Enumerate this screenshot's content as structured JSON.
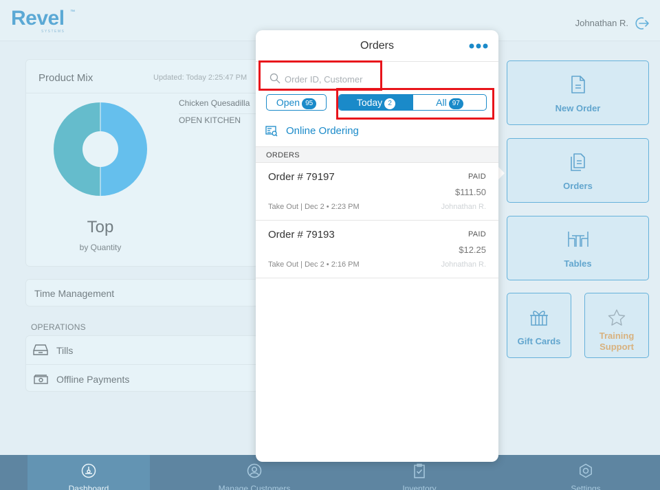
{
  "header": {
    "brand": "Revel",
    "brand_sub": "SYSTEMS",
    "brand_tm": "™",
    "user_name": "Johnathan R."
  },
  "product_mix": {
    "title": "Product Mix",
    "updated": "Updated: Today 2:25:47 PM",
    "items": [
      "Chicken Quesadilla",
      "OPEN KITCHEN"
    ],
    "top_label": "Top",
    "by_label": "by Quantity",
    "colors": {
      "left": "#1a9db0",
      "right": "#1aa3e8"
    }
  },
  "time_management": {
    "label": "Time Management"
  },
  "operations": {
    "heading": "OPERATIONS",
    "items": [
      {
        "label": "Tills",
        "icon": "till-drawer-icon"
      },
      {
        "label": "Offline Payments",
        "icon": "cash-icon"
      }
    ]
  },
  "tiles": {
    "new_order": "New Order",
    "orders": "Orders",
    "tables": "Tables",
    "gift_cards": "Gift Cards",
    "training_line1": "Training",
    "training_line2": "Support"
  },
  "bottom_nav": {
    "items": [
      {
        "label": "Dashboard",
        "icon": "dashboard-gauge-icon",
        "active": true
      },
      {
        "label": "Manage Customers",
        "icon": "customer-icon",
        "active": false
      },
      {
        "label": "Inventory",
        "icon": "clipboard-check-icon",
        "active": false
      },
      {
        "label": "Settings",
        "icon": "gear-icon",
        "active": false
      }
    ]
  },
  "orders_popover": {
    "title": "Orders",
    "search_placeholder": "Order ID, Customer",
    "filters": {
      "open_label": "Open",
      "open_count": "95",
      "today_label": "Today",
      "today_count": "2",
      "all_label": "All",
      "all_count": "97"
    },
    "online_ordering": "Online Ordering",
    "section_label": "ORDERS",
    "orders": [
      {
        "id": "Order # 79197",
        "status": "PAID",
        "amount": "$111.50",
        "meta": "Take Out | Dec 2 • 2:23 PM",
        "employee": "Johnathan R."
      },
      {
        "id": "Order # 79193",
        "status": "PAID",
        "amount": "$12.25",
        "meta": "Take Out | Dec 2 • 2:16 PM",
        "employee": "Johnathan R."
      }
    ]
  },
  "colors": {
    "accent": "#1a8ac9",
    "nav_bg": "#0e3f66",
    "highlight": "#e8141b",
    "training": "#e08a2a"
  }
}
